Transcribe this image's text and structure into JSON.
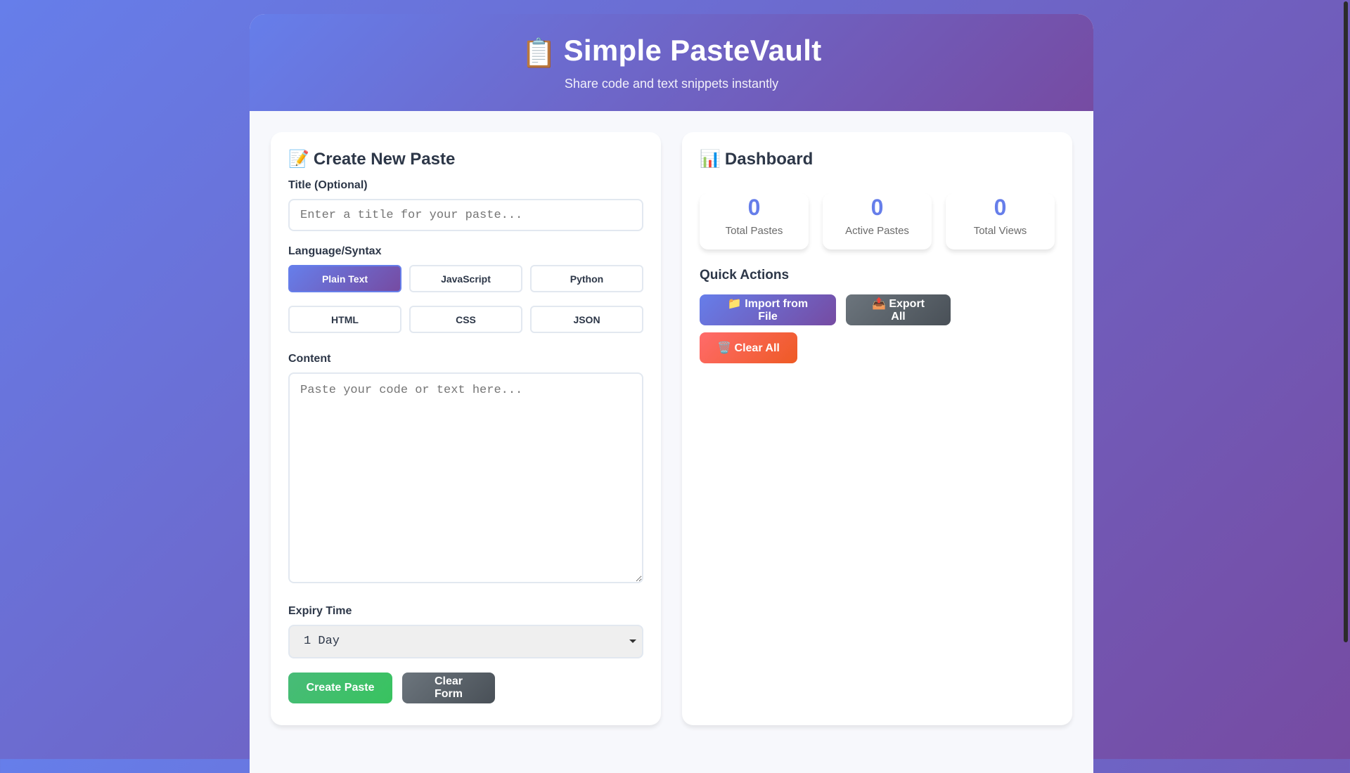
{
  "header": {
    "icon": "📋",
    "title": "Simple PasteVault",
    "subtitle": "Share code and text snippets instantly"
  },
  "create": {
    "icon": "📝",
    "title": "Create New Paste",
    "title_label": "Title (Optional)",
    "title_placeholder": "Enter a title for your paste...",
    "language_label": "Language/Syntax",
    "languages": [
      "Plain Text",
      "JavaScript",
      "Python",
      "HTML",
      "CSS",
      "JSON"
    ],
    "active_language": "Plain Text",
    "content_label": "Content",
    "content_placeholder": "Paste your code or text here...",
    "expiry_label": "Expiry Time",
    "expiry_value": "1 Day",
    "create_button": "Create Paste",
    "clear_button": "Clear Form"
  },
  "dashboard": {
    "icon": "📊",
    "title": "Dashboard",
    "stats": [
      {
        "value": "0",
        "label": "Total Pastes"
      },
      {
        "value": "0",
        "label": "Active Pastes"
      },
      {
        "value": "0",
        "label": "Total Views"
      }
    ],
    "quick_actions_title": "Quick Actions",
    "import_button": "📁 Import from File",
    "export_button": "📤 Export All",
    "clear_all_button": "🗑️ Clear All"
  },
  "colors": {
    "accent": "#667eea",
    "accent_end": "#764ba2",
    "success": "#48bb78",
    "danger": "#ee5a24"
  }
}
